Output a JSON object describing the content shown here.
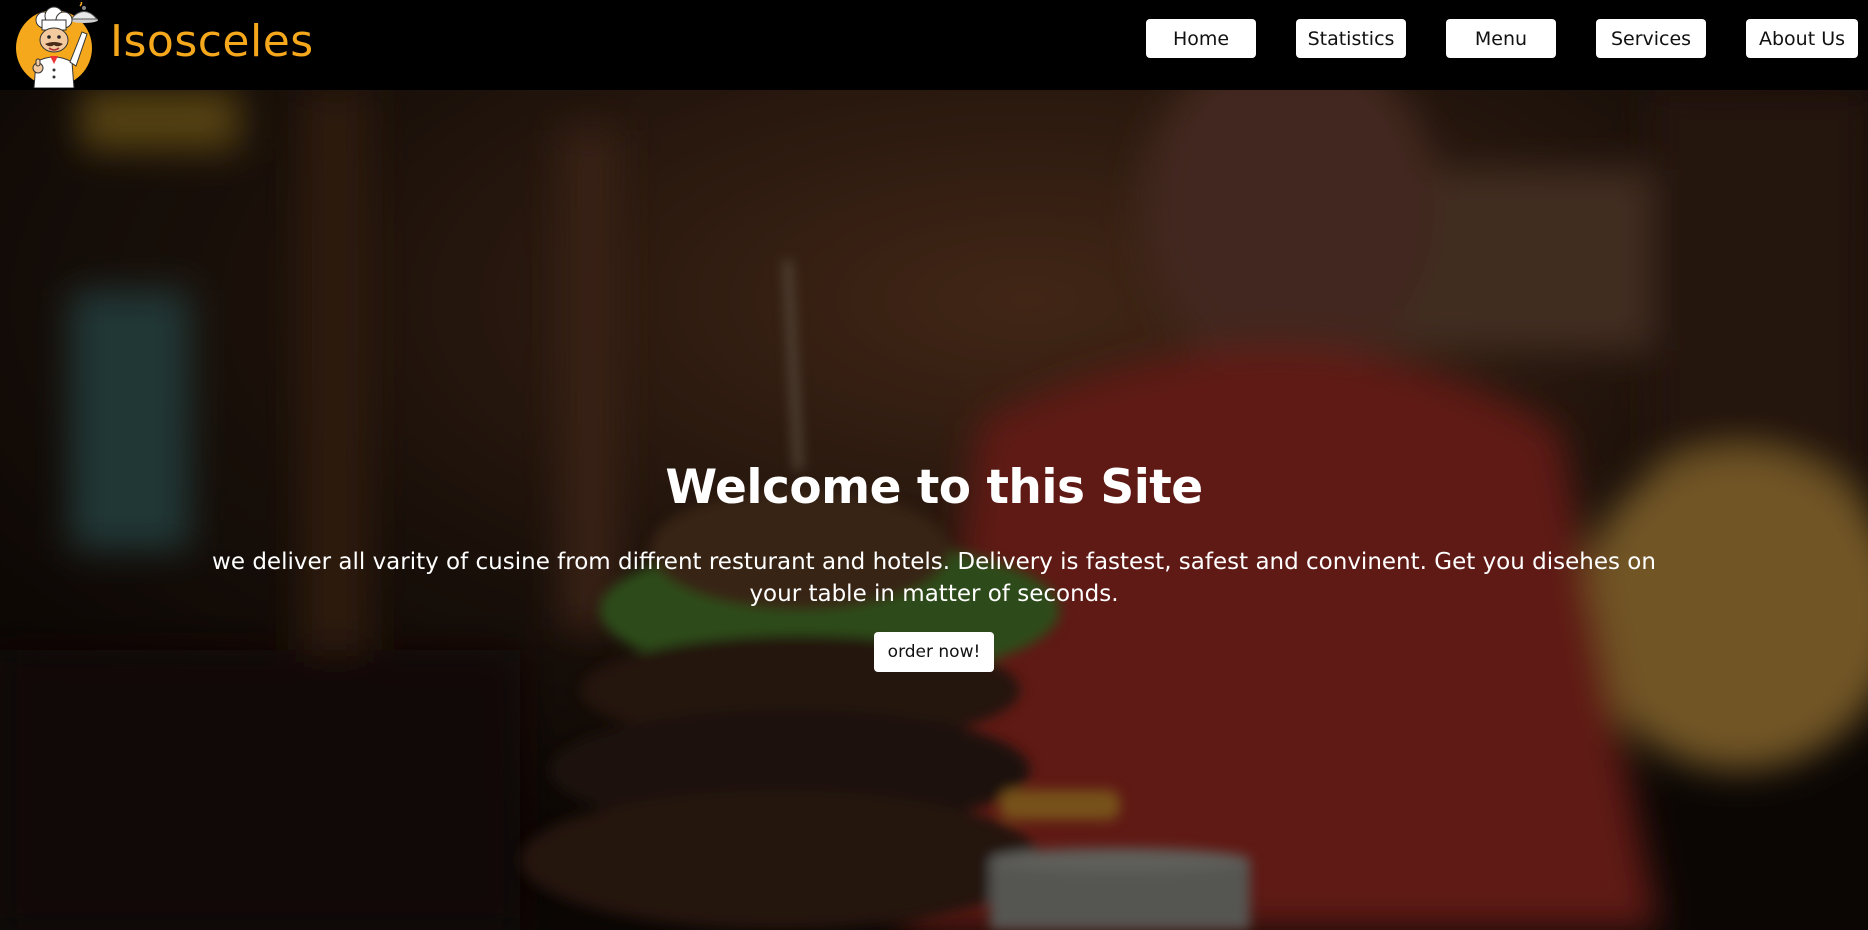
{
  "brand": {
    "name": "Isosceles",
    "color": "#f5a81c",
    "logo_icon": "chef-mascot-icon"
  },
  "nav": {
    "items": [
      {
        "label": "Home"
      },
      {
        "label": "Statistics"
      },
      {
        "label": "Menu"
      },
      {
        "label": "Services"
      },
      {
        "label": "About Us"
      }
    ]
  },
  "hero": {
    "title": "Welcome to this Site",
    "text": "we deliver all varity of cusine from diffrent resturant and hotels. Delivery is fastest, safest and convinent. Get you disehes on your table in matter of seconds.",
    "cta_label": "order now!",
    "background": "blurred-restaurant-photo-with-burger-and-waiter"
  }
}
